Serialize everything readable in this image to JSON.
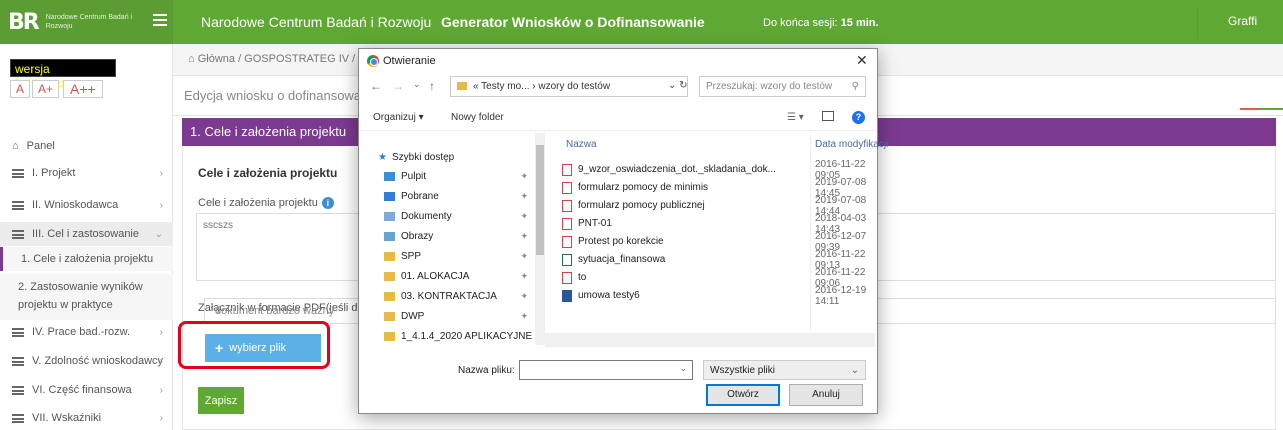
{
  "topbar": {
    "org_name": "Narodowe Centrum Badań i Rozwoju",
    "logo_text": "Narodowe Centrum Badań i Rozwoju",
    "app_title": "Generator Wniosków o Dofinansowanie",
    "session_label": "Do końca sesji:",
    "session_value": "15 min.",
    "user": "Graffi",
    "accent": "#5fa833"
  },
  "accessibility": {
    "contrast": "wersja kontrastowa",
    "font_small": "A",
    "font_medium": "A+",
    "font_large": "A++"
  },
  "sidebar": {
    "panel": "Panel",
    "items": [
      {
        "label": "I. Projekt"
      },
      {
        "label": "II. Wnioskodawca"
      },
      {
        "label": "III. Cel i zastosowanie"
      },
      {
        "label": "IV. Prace bad.-rozw."
      },
      {
        "label": "V. Zdolność wnioskodawcy"
      },
      {
        "label": "VI. Część finansowa"
      },
      {
        "label": "VII. Wskaźniki"
      }
    ],
    "sub_items": [
      "1. Cele i założenia projektu",
      "2. Zastosowanie wyników projektu w praktyce"
    ]
  },
  "main": {
    "breadcrumb": "Główna / GOSPOSTRATEG IV /",
    "subtitle": "Edycja wniosku o dofinansowan",
    "section_title": "1. Cele i założenia projektu",
    "form_heading": "Cele i założenia projektu",
    "field_label": "Cele i założenia projektu",
    "field_value": "sscszs",
    "attach_label": "Załącznik w formacie PDF(jeśli doty",
    "doc_value": "dokument bardzo ważny",
    "pick_button": "wybierz plik",
    "save_button": "Zapisz",
    "section_color": "#7b3a8f"
  },
  "dialog": {
    "title": "Otwieranie",
    "address": "« Testy mo... › wzory do testów",
    "search_placeholder": "Przeszukaj: wzory do testów",
    "organize": "Organizuj ▾",
    "new_folder": "Nowy folder",
    "nav": [
      "Szybki dostęp",
      "Pulpit",
      "Pobrane",
      "Dokumenty",
      "Obrazy",
      "SPP",
      "01. ALOKACJA",
      "03. KONTRAKTACJA",
      "DWP",
      "1_4.1.4_2020 APLIKACYJNE"
    ],
    "col_name": "Nazwa",
    "col_date": "Data modyfikacji",
    "files": [
      {
        "name": "9_wzor_oswiadczenia_dot._skladania_dok...",
        "date": "2016-11-22 09:05",
        "icon": "pdf"
      },
      {
        "name": "formularz pomocy de minimis",
        "date": "2019-07-08 14:45",
        "icon": "pdf"
      },
      {
        "name": "formularz pomocy publicznej",
        "date": "2019-07-08 14:44",
        "icon": "pdf"
      },
      {
        "name": "PNT-01",
        "date": "2018-04-03 14:43",
        "icon": "pdf"
      },
      {
        "name": "Protest po korekcie",
        "date": "2016-12-07 09:39",
        "icon": "pdf"
      },
      {
        "name": "sytuacja_finansowa",
        "date": "2016-11-22 09:13",
        "icon": "xls"
      },
      {
        "name": "to",
        "date": "2016-11-22 09:06",
        "icon": "pdf"
      },
      {
        "name": "umowa testy6",
        "date": "2016-12-19 14:11",
        "icon": "doc"
      }
    ],
    "file_name_label": "Nazwa pliku:",
    "file_type": "Wszystkie pliki",
    "open_button": "Otwórz",
    "cancel_button": "Anuluj"
  }
}
